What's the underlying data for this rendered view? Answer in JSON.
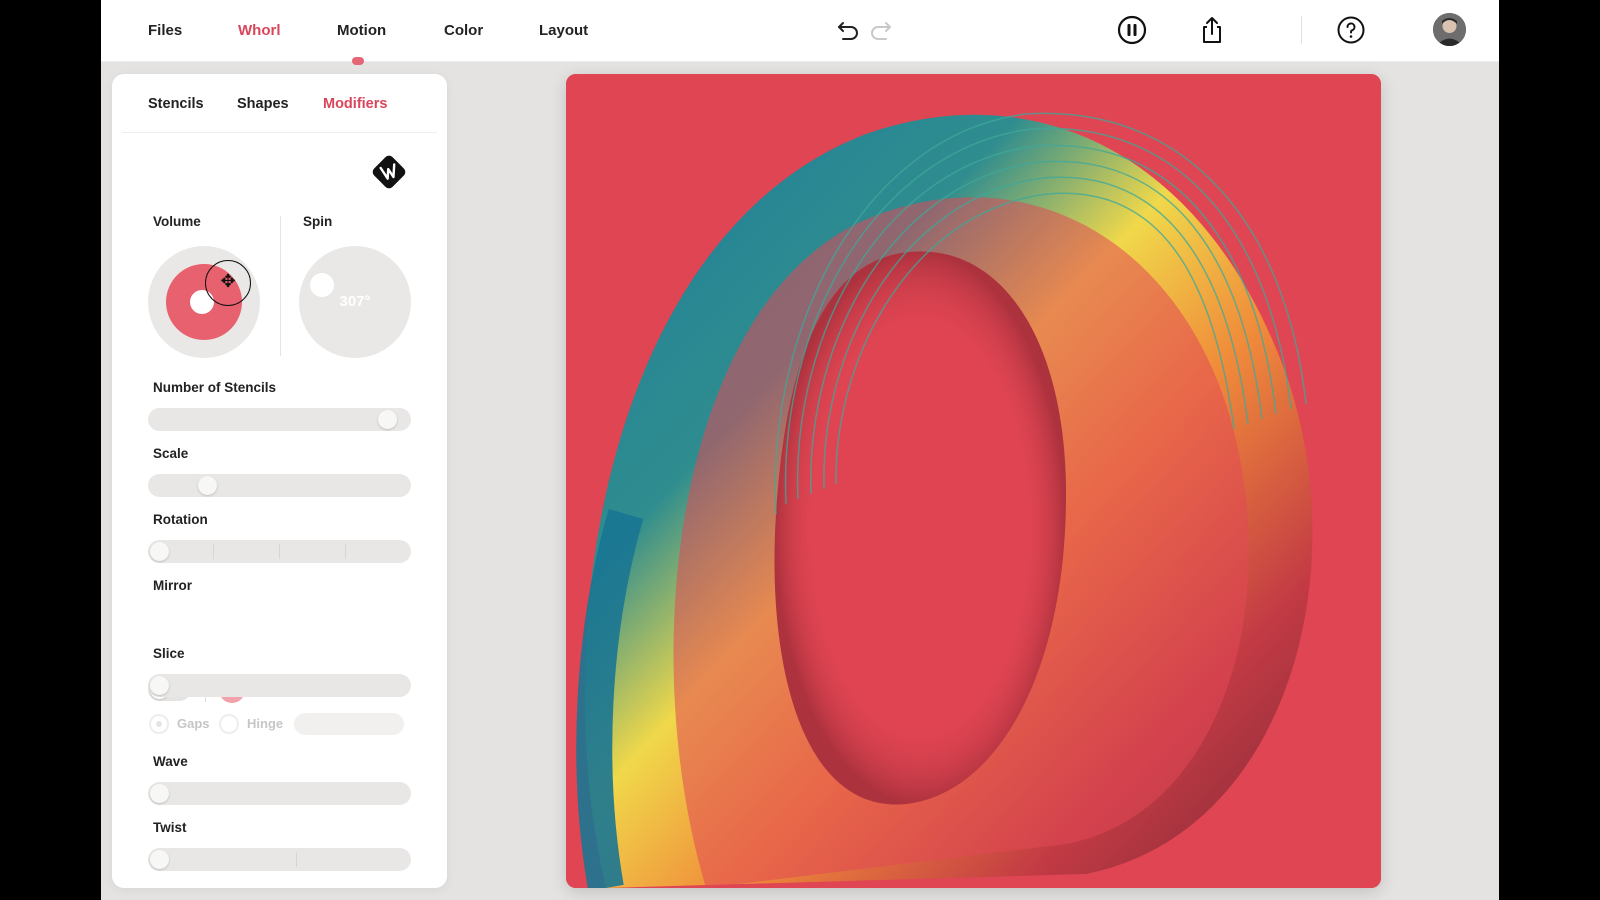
{
  "topbar": {
    "nav": [
      "Files",
      "Whorl",
      "Motion",
      "Color",
      "Layout"
    ],
    "active_nav": "Whorl"
  },
  "panel": {
    "tabs": [
      "Stencils",
      "Shapes",
      "Modifiers"
    ],
    "active_tab": "Modifiers",
    "volume_label": "Volume",
    "spin_label": "Spin",
    "spin_value": "307°",
    "stencils_label": "Number of Stencils",
    "stencils_level": 0.95,
    "scale_label": "Scale",
    "scale_level": 0.2,
    "rotation_label": "Rotation",
    "rotation_level": 0.0,
    "mirror_label": "Mirror",
    "mirror_on": false,
    "mirror_color": "#f2a2aa",
    "mirror_add": "+",
    "slice_label": "Slice",
    "slice_level": 0.0,
    "gaps_label": "Gaps",
    "hinge_label": "Hinge",
    "wave_label": "Wave",
    "wave_level": 0.0,
    "twist_label": "Twist",
    "twist_level": 0.0
  },
  "colors": {
    "accent": "#d9465a",
    "canvas_bg": "#df4552",
    "volume_fill": "#e8616f"
  },
  "icons": {
    "undo": "undo-icon",
    "redo": "redo-icon",
    "pause": "pause-icon",
    "share": "share-icon",
    "help": "help-icon"
  }
}
